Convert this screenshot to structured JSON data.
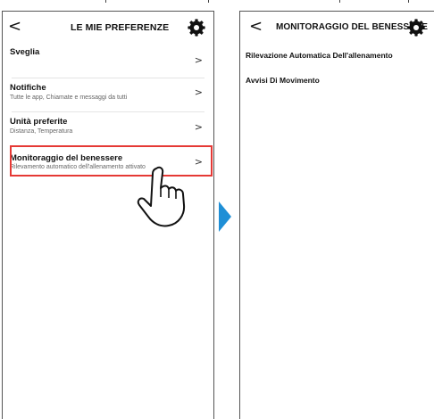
{
  "left_screen": {
    "back_glyph": "<",
    "title": "LE MIE PREFERENZE",
    "settings_icon": "gear-icon",
    "items": [
      {
        "title": "Sveglia",
        "subtitle": ""
      },
      {
        "title": "Notifiche",
        "subtitle": "Tutte le app, Chiamate e messaggi da tutti"
      },
      {
        "title": "Unità preferite",
        "subtitle": "Distanza, Temperatura"
      },
      {
        "title": "Monitoraggio del benessere",
        "subtitle": "Rilevamento automatico dell'allenamento attivato"
      }
    ],
    "chevron": ">"
  },
  "right_screen": {
    "back_glyph": "<",
    "title": "MONITORAGGIO DEL BENESSERE",
    "settings_icon": "gear-icon",
    "items": [
      {
        "title": "Rilevazione Automatica Dell'allenamento"
      },
      {
        "title": "Avvisi Di Movimento"
      }
    ],
    "chevron": ">"
  },
  "colors": {
    "highlight": "#e53935",
    "arrow": "#1f8fd6"
  }
}
